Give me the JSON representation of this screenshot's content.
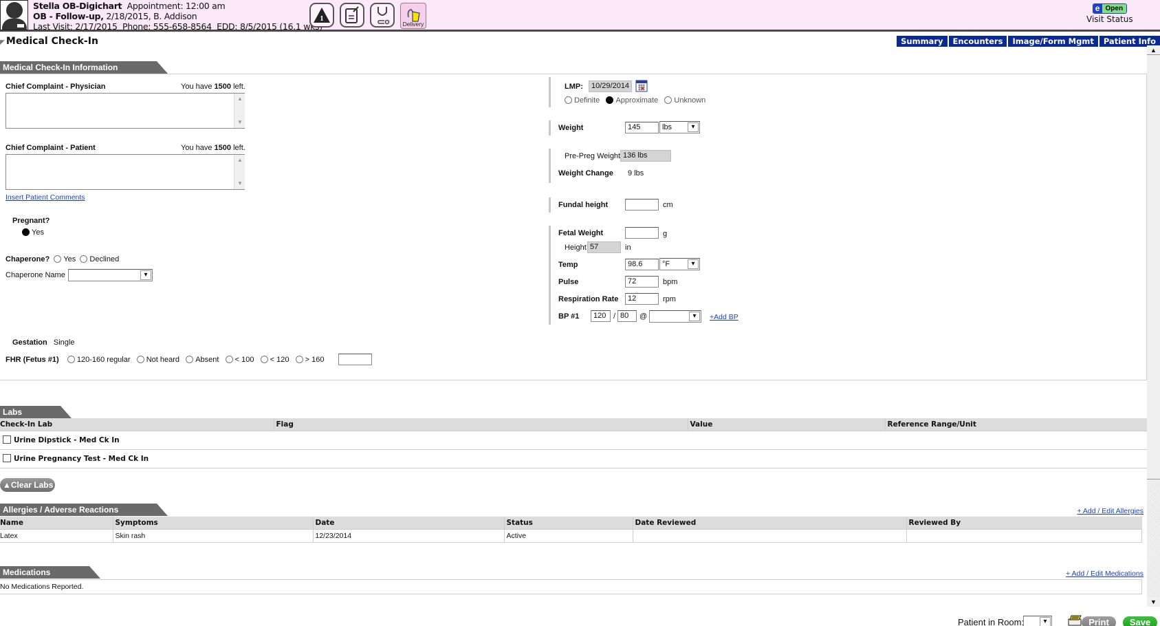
{
  "header": {
    "patient_name": "Stella OB-Digichart",
    "appointment": "Appointment: 12:00 am",
    "visit_type": "OB - Follow-up,",
    "visit_detail": "2/18/2015, B. Addison",
    "last_visit": "Last Visit: 2/17/2015",
    "phone": "Phone: 555-658-8564",
    "edd": "EDD: 8/5/2015 (16.1 wks)",
    "tool_icons": [
      {
        "name": "alert-icon",
        "badge": "1"
      },
      {
        "name": "notes-edit-icon"
      },
      {
        "name": "stethoscope-icon"
      },
      {
        "name": "delivery-icon",
        "label": "Delivery"
      }
    ],
    "visit_status": {
      "icon_letter": "e",
      "status": "Open",
      "label": "Visit Status"
    }
  },
  "page": {
    "title": "Medical Check-In",
    "nav_tabs": [
      "Summary",
      "Encounters",
      "Image/Form Mgmt",
      "Patient Info"
    ]
  },
  "checkin": {
    "section_title": "Medical Check-In Information",
    "chief_physician": {
      "label": "Chief Complaint - Physician",
      "counter_prefix": "You have",
      "counter_value": "1500",
      "counter_suffix": "left.",
      "value": ""
    },
    "chief_patient": {
      "label": "Chief Complaint - Patient",
      "counter_prefix": "You have",
      "counter_value": "1500",
      "counter_suffix": "left.",
      "value": ""
    },
    "insert_comments_link": "Insert Patient Comments",
    "pregnant": {
      "label": "Pregnant?",
      "option": "Yes",
      "selected": true
    },
    "chaperone": {
      "label": "Chaperone?",
      "options": [
        "Yes",
        "Declined"
      ],
      "selected": null
    },
    "chaperone_name": {
      "label": "Chaperone Name",
      "value": ""
    },
    "gestation": {
      "label": "Gestation",
      "value": "Single"
    },
    "fhr": {
      "label": "FHR (Fetus #1)",
      "options": [
        "120-160 regular",
        "Not heard",
        "Absent",
        "< 100",
        "< 120",
        "> 160"
      ],
      "selected": null,
      "value": ""
    },
    "lmp": {
      "label": "LMP:",
      "value": "10/29/2014",
      "options": [
        "Definite",
        "Approximate",
        "Unknown"
      ],
      "selected": "Approximate"
    },
    "weight": {
      "label": "Weight",
      "value": "145",
      "unit": "lbs"
    },
    "pre_preg_weight": {
      "label": "Pre-Preg Weight",
      "value": "136 lbs"
    },
    "weight_change": {
      "label": "Weight Change",
      "value": "9 lbs"
    },
    "fundal_height": {
      "label": "Fundal height",
      "value": "",
      "unit": "cm"
    },
    "fetal_weight": {
      "label": "Fetal Weight",
      "value": "",
      "unit": "g"
    },
    "height": {
      "label": "Height",
      "value": "57",
      "unit": "in"
    },
    "temp": {
      "label": "Temp",
      "value": "98.6",
      "unit": "°F"
    },
    "pulse": {
      "label": "Pulse",
      "value": "72",
      "unit": "bpm"
    },
    "respiration": {
      "label": "Respiration Rate",
      "value": "12",
      "unit": "rpm"
    },
    "bp": {
      "label": "BP #1",
      "systolic": "120",
      "separator": "/",
      "diastolic": "80",
      "at": "@",
      "position": "",
      "add_link": "+Add BP"
    }
  },
  "labs": {
    "section_title": "Labs",
    "columns": [
      "Check-In Lab",
      "Flag",
      "Value",
      "Reference Range/Unit"
    ],
    "rows": [
      {
        "name": "Urine Dipstick - Med Ck In",
        "checked": false
      },
      {
        "name": "Urine Pregnancy Test - Med Ck In",
        "checked": false
      }
    ],
    "clear_button": "Clear Labs"
  },
  "allergies": {
    "section_title": "Allergies / Adverse Reactions",
    "add_link": "+ Add / Edit Allergies",
    "columns": [
      "Name",
      "Symptoms",
      "Date",
      "Status",
      "Date Reviewed",
      "Reviewed By"
    ],
    "rows": [
      [
        "Latex",
        "Skin rash",
        "12/23/2014",
        "Active",
        "",
        ""
      ]
    ]
  },
  "medications": {
    "section_title": "Medications",
    "add_link": "+ Add / Edit Medications",
    "empty_text": "No Medications Reported."
  },
  "footer": {
    "patient_in_room_label": "Patient in Room:",
    "patient_in_room_value": "",
    "print_label": "Print",
    "save_label": "Save"
  }
}
